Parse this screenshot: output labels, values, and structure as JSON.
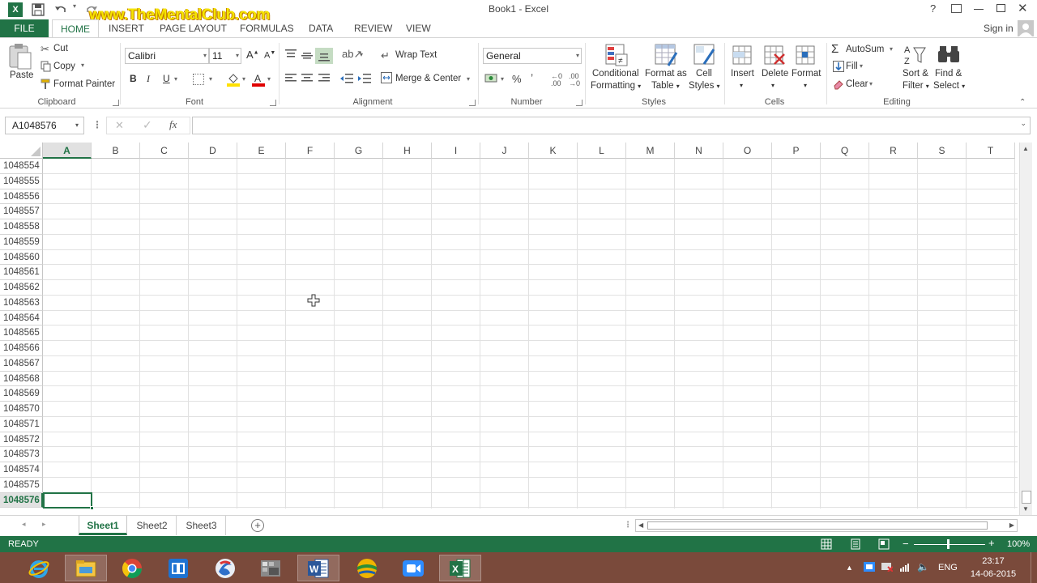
{
  "window": {
    "title": "Book1 - Excel",
    "watermark": "www.TheMentalClub.com",
    "signin": "Sign in",
    "help": "?"
  },
  "tabs": [
    "FILE",
    "HOME",
    "INSERT",
    "PAGE LAYOUT",
    "FORMULAS",
    "DATA",
    "REVIEW",
    "VIEW"
  ],
  "ribbon": {
    "clipboard": {
      "paste": "Paste",
      "cut": "Cut",
      "copy": "Copy",
      "format_painter": "Format Painter",
      "label": "Clipboard"
    },
    "font": {
      "name": "Calibri",
      "size": "11",
      "bold": "B",
      "italic": "I",
      "underline": "U",
      "label": "Font"
    },
    "alignment": {
      "wrap_text": "Wrap Text",
      "merge_center": "Merge & Center",
      "label": "Alignment"
    },
    "number": {
      "format": "General",
      "percent": "%",
      "comma": "’",
      "label": "Number"
    },
    "styles": {
      "conditional": [
        "Conditional",
        "Formatting"
      ],
      "format_table": [
        "Format as",
        "Table"
      ],
      "cell_styles": [
        "Cell",
        "Styles"
      ],
      "label": "Styles"
    },
    "cells": {
      "insert": "Insert",
      "delete": "Delete",
      "format": "Format",
      "label": "Cells"
    },
    "editing": {
      "autosum": "AutoSum",
      "fill": "Fill",
      "clear": "Clear",
      "sort_filter": [
        "Sort &",
        "Filter"
      ],
      "find_select": [
        "Find &",
        "Select"
      ],
      "label": "Editing"
    }
  },
  "formula_bar": {
    "name_box": "A1048576",
    "fx": "fx",
    "value": ""
  },
  "grid": {
    "columns": [
      "A",
      "B",
      "C",
      "D",
      "E",
      "F",
      "G",
      "H",
      "I",
      "J",
      "K",
      "L",
      "M",
      "N",
      "O",
      "P",
      "Q",
      "R",
      "S",
      "T"
    ],
    "selected_column": "A",
    "rows": [
      "1048554",
      "1048555",
      "1048556",
      "1048557",
      "1048558",
      "1048559",
      "1048560",
      "1048561",
      "1048562",
      "1048563",
      "1048564",
      "1048565",
      "1048566",
      "1048567",
      "1048568",
      "1048569",
      "1048570",
      "1048571",
      "1048572",
      "1048573",
      "1048574",
      "1048575",
      "1048576"
    ],
    "selected_row": "1048576"
  },
  "sheets": [
    "Sheet1",
    "Sheet2",
    "Sheet3"
  ],
  "active_sheet": "Sheet1",
  "status": {
    "mode": "READY",
    "zoom": "100%"
  },
  "taskbar": {
    "apps": [
      "internet-explorer-icon",
      "file-explorer-icon",
      "chrome-icon",
      "meeting-app-icon",
      "browser-app-icon",
      "photo-app-icon",
      "word-icon",
      "app-icon",
      "video-call-icon",
      "excel-icon"
    ],
    "language": "ENG",
    "time": "23:17",
    "date": "14-06-2015"
  }
}
